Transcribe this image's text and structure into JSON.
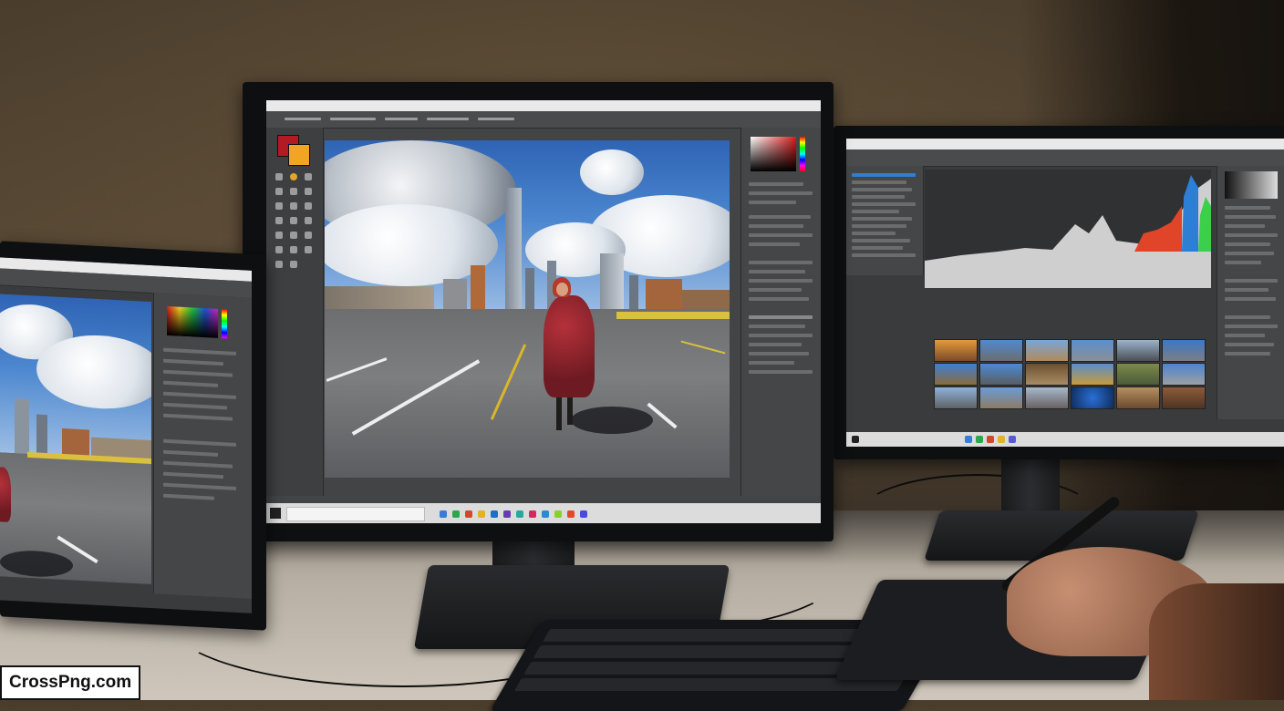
{
  "watermark": {
    "text": "CrossPng.com"
  },
  "monitor_left": {
    "brand": ""
  },
  "monitor_center": {
    "brand": ""
  },
  "monitor_right": {
    "brand": ""
  },
  "colors": {
    "wall": "#4a3d2c",
    "desk": "#b6aea2",
    "ui_dark": "#3a3b3d",
    "sky": "#3f78c4",
    "coat": "#b5313a",
    "histogram_red": "#e0452a",
    "histogram_blue": "#2d7fd6",
    "histogram_green": "#3ccf4b"
  },
  "icons": [
    "color-picker-icon",
    "brush-icon",
    "layers-icon",
    "search-icon",
    "windows-start-icon"
  ]
}
